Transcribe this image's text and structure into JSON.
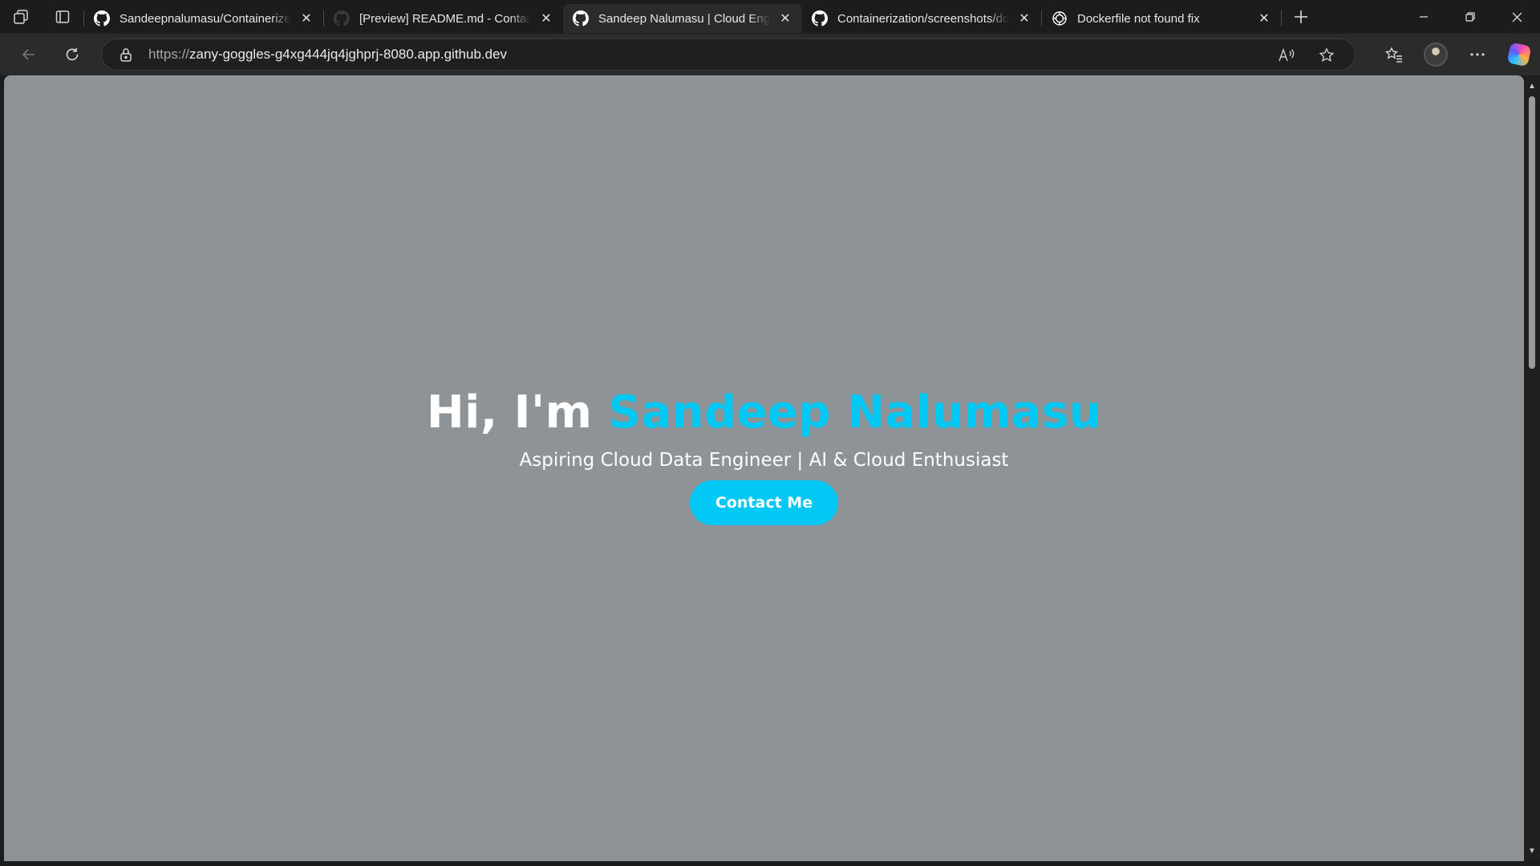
{
  "browser": {
    "tabs": [
      {
        "title": "Sandeepnalumasu/Containerize",
        "favicon": "github-icon",
        "active": false
      },
      {
        "title": "[Preview] README.md - Containerization",
        "favicon": "github-dim-icon",
        "active": false
      },
      {
        "title": "Sandeep Nalumasu | Cloud Engineer",
        "favicon": "github-icon",
        "active": true
      },
      {
        "title": "Containerization/screenshots/docker",
        "favicon": "github-icon",
        "active": false
      },
      {
        "title": "Dockerfile not found fix",
        "favicon": "chatgpt-icon",
        "active": false
      }
    ],
    "address": {
      "scheme": "https://",
      "host": "zany-goggles-g4xg444jq4jghprj-8080.app.github.dev"
    }
  },
  "page": {
    "greeting": "Hi, I'm ",
    "name": "Sandeep Nalumasu",
    "subtitle": "Aspiring Cloud Data Engineer | AI & Cloud Enthusiast",
    "cta_label": "Contact Me",
    "background_color": "#8e9397",
    "accent_color": "#00c8f5"
  }
}
